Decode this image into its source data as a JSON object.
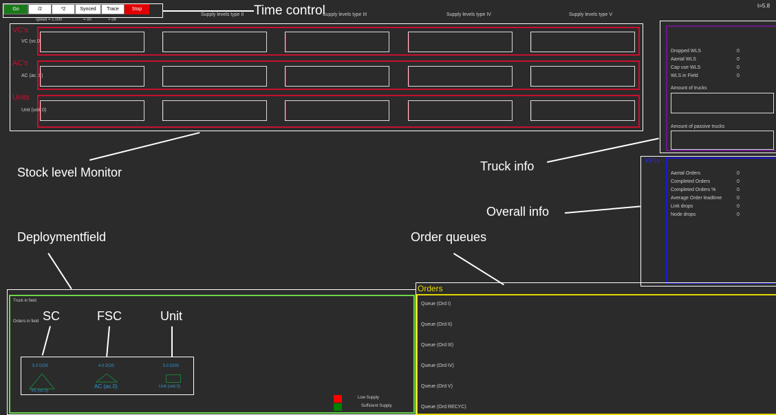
{
  "time_control": {
    "buttons": [
      {
        "label": "Go",
        "color": "#1a7a1a"
      },
      {
        "label": "/2",
        "color": "#ffffff"
      },
      {
        "label": "*2",
        "color": "#ffffff"
      },
      {
        "label": "Synced",
        "color": "#ffffff"
      },
      {
        "label": "Trace",
        "color": "#ffffff"
      },
      {
        "label": "Stop",
        "color": "#e00000"
      }
    ],
    "speed": "speed = 1.000",
    "synced_state": "= on",
    "trace_state": "= off",
    "time_display": "t=5.8"
  },
  "annotations": {
    "time_control": "Time control",
    "stock_level_monitor": "Stock level Monitor",
    "truck_info": "Truck info",
    "overall_info": "Overall info",
    "deploymentfield": "Deploymentfield",
    "order_queues": "Order queues",
    "sc": "SC",
    "fsc": "FSC",
    "unit": "Unit"
  },
  "supply_headers": [
    "Supply levels type II",
    "Supply levels type III",
    "Supply levels type IV",
    "Supply levels type V"
  ],
  "stock_groups": [
    {
      "title": "VC's",
      "row_label": "VC (vc.0)"
    },
    {
      "title": "AC's",
      "row_label": "AC (ac. 0)"
    },
    {
      "title": "Units",
      "row_label": "Unit (unit.0)"
    }
  ],
  "truck_info": {
    "rows": [
      {
        "label": "Dropped WLS",
        "value": "0"
      },
      {
        "label": "Aantal WLS",
        "value": "0"
      },
      {
        "label": "Cap use WLS",
        "value": "0"
      },
      {
        "label": "WLS in Field",
        "value": "0"
      }
    ],
    "amount_trucks": "Amount of trucks",
    "amount_passive_trucks": "Amount of passive trucks"
  },
  "kpis": {
    "title": "KPIs",
    "rows": [
      {
        "label": "Aantal Orders",
        "value": "0"
      },
      {
        "label": "Completed Orders",
        "value": "0"
      },
      {
        "label": "Completed Orders %",
        "value": "0"
      },
      {
        "label": "Average Order leadtime",
        "value": "0"
      },
      {
        "label": "Link drops",
        "value": "0"
      },
      {
        "label": "Node drops",
        "value": "0"
      }
    ]
  },
  "deployment": {
    "truck_in_field": "Truck in field",
    "orders_in_field": "Orders in field",
    "nodes": [
      {
        "dos": "5.0 DOS",
        "name": "VC (vc.0)"
      },
      {
        "dos": "4.0 DOS",
        "name": "AC (ac.0)"
      },
      {
        "dos": "5.0 DOS",
        "name": "Unit (unit.0)"
      }
    ],
    "legend": [
      {
        "label": "Low Supply",
        "color": "#ff0000"
      },
      {
        "label": "Sufficient Supply",
        "color": "#008000"
      }
    ]
  },
  "orders": {
    "title": "Orders",
    "queues": [
      "Queue (Ord I)",
      "Queue (Ord II)",
      "Queue (Ord III)",
      "Queue (Ord IV)",
      "Queue (Ord V)",
      "Queue (Ord RECYC)"
    ]
  }
}
